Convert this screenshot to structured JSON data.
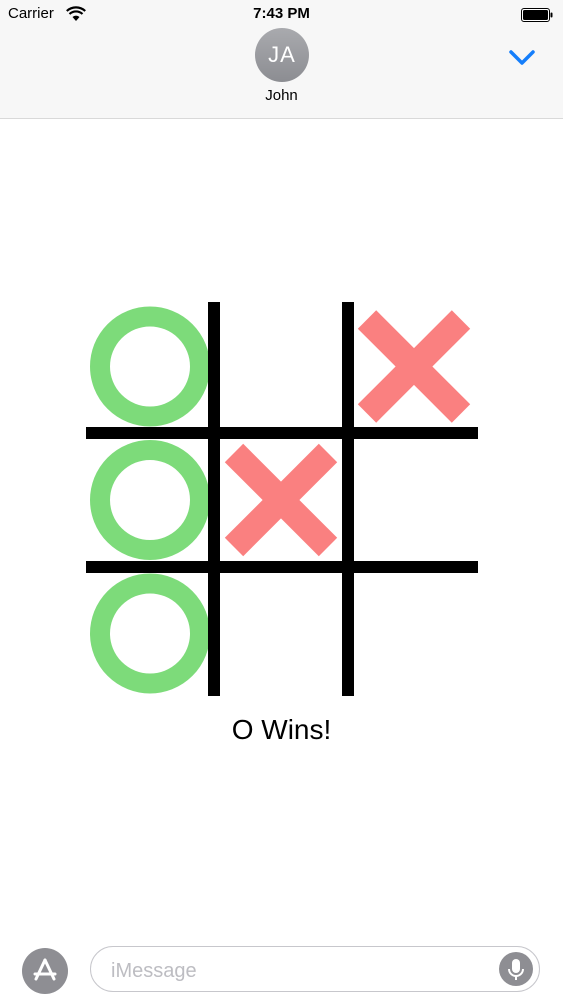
{
  "status_bar": {
    "carrier": "Carrier",
    "time": "7:43 PM"
  },
  "header": {
    "avatar_initials": "JA",
    "contact_name": "John"
  },
  "game": {
    "board": [
      [
        "O",
        "",
        "X"
      ],
      [
        "O",
        "X",
        ""
      ],
      [
        "O",
        "",
        ""
      ]
    ],
    "result_text": "O Wins!",
    "colors": {
      "o": "#7ddb7a",
      "x": "#fa8080",
      "grid": "#000000"
    }
  },
  "compose": {
    "placeholder": "iMessage"
  },
  "colors": {
    "accent": "#157efb",
    "header_bg": "#f7f7f7",
    "button_gray": "#8e8e93"
  }
}
